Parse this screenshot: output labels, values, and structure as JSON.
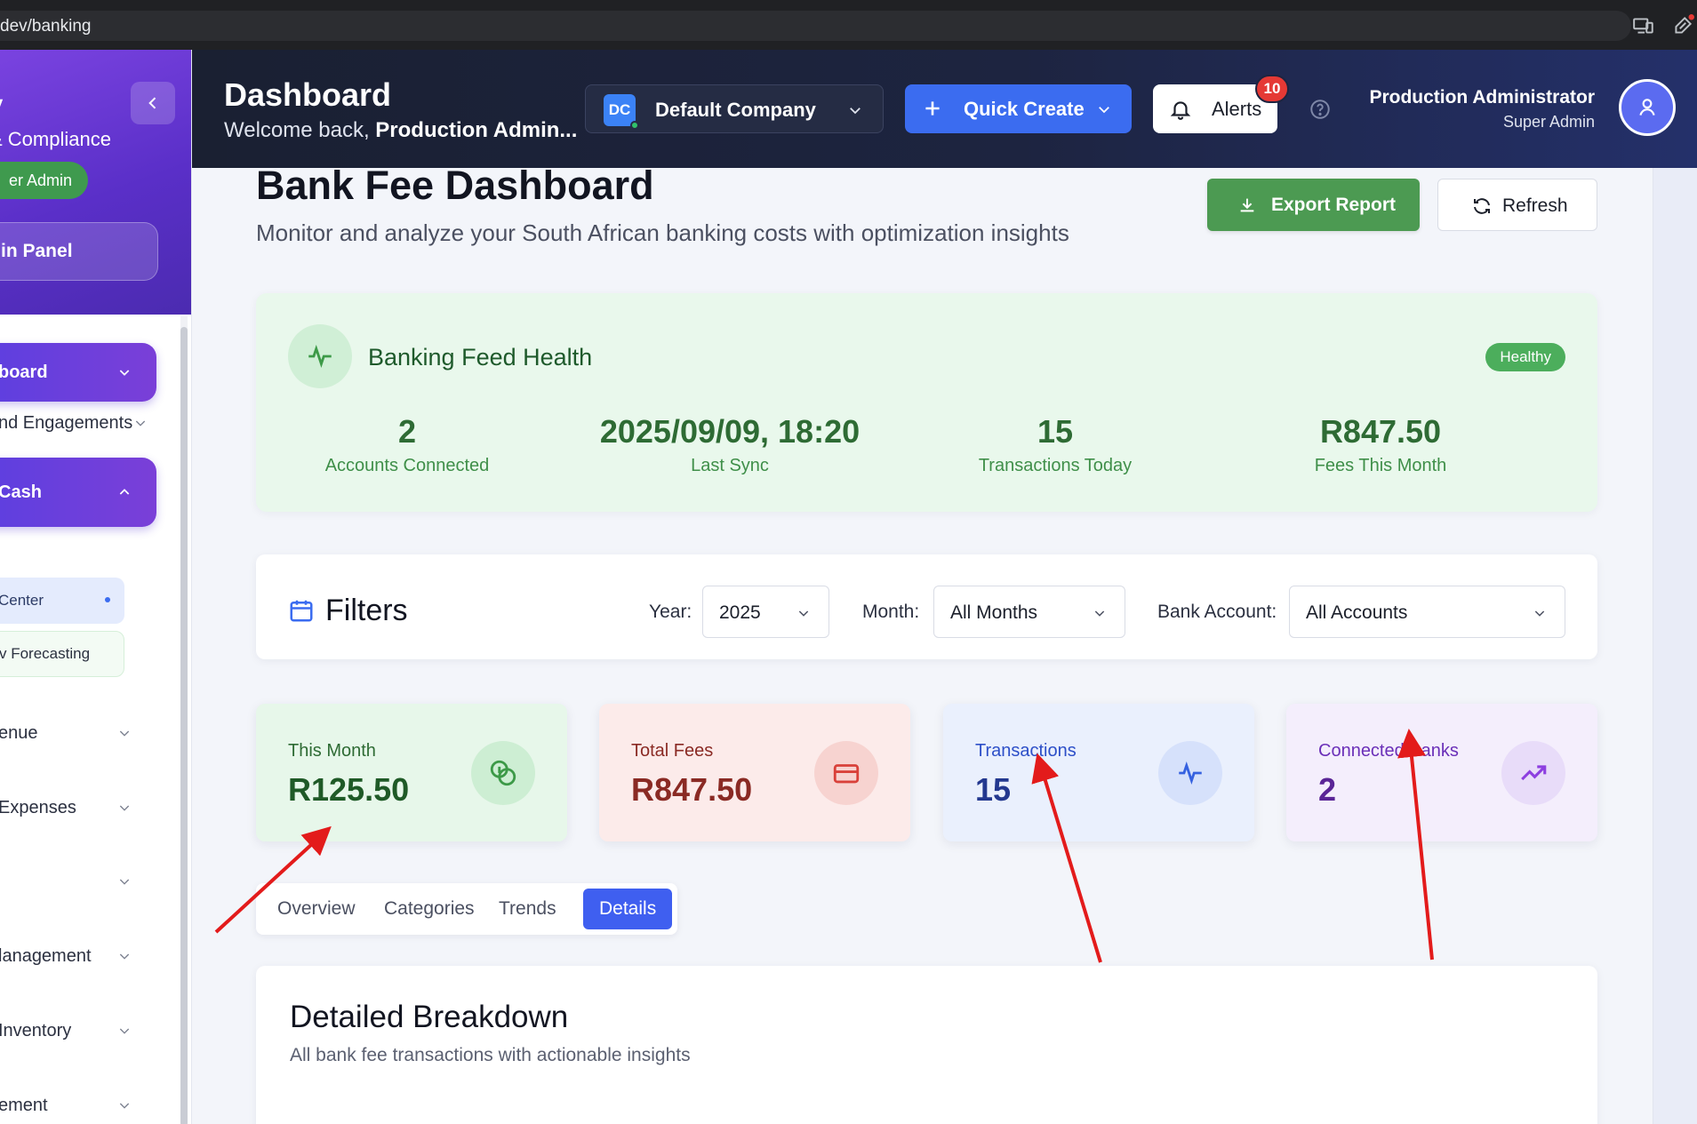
{
  "browser": {
    "url_text": "dev/banking"
  },
  "sidebar": {
    "brand_name": "fy",
    "brand_subtitle": "& Compliance",
    "role_pill": "er Admin",
    "admin_panel": "in Panel",
    "items": [
      {
        "label": "board",
        "active": true,
        "expanded": false
      },
      {
        "label": "nd Engagements",
        "active": false
      },
      {
        "label": "Cash",
        "active": true,
        "expanded": true
      },
      {
        "label": "Center",
        "sub": true,
        "selected": true
      },
      {
        "label": "v Forecasting",
        "sub": true
      },
      {
        "label": "enue",
        "active": false
      },
      {
        "label": " Expenses",
        "active": false
      },
      {
        "label": "",
        "active": false
      },
      {
        "label": "lanagement",
        "active": false
      },
      {
        "label": "Inventory",
        "active": false
      },
      {
        "label": "ement",
        "active": false
      }
    ]
  },
  "header": {
    "title": "Dashboard",
    "welcome_prefix": "Welcome back, ",
    "welcome_name": "Production Admin...",
    "company": {
      "initials": "DC",
      "name": "Default Company"
    },
    "quick_create_label": "Quick Create",
    "alerts_label": "Alerts",
    "alerts_count": "10",
    "user_name": "Production Administrator",
    "user_role": "Super Admin"
  },
  "page": {
    "title": "Bank Fee Dashboard",
    "subtitle": "Monitor and analyze your South African banking costs with optimization insights",
    "export_label": "Export Report",
    "refresh_label": "Refresh"
  },
  "feed_health": {
    "title": "Banking Feed Health",
    "status": "Healthy",
    "stats": [
      {
        "value": "2",
        "label": "Accounts Connected"
      },
      {
        "value": "2025/09/09, 18:20",
        "label": "Last Sync"
      },
      {
        "value": "15",
        "label": "Transactions Today"
      },
      {
        "value": "R847.50",
        "label": "Fees This Month"
      }
    ]
  },
  "filters": {
    "title": "Filters",
    "year_label": "Year:",
    "year_value": "2025",
    "month_label": "Month:",
    "month_value": "All Months",
    "account_label": "Bank Account:",
    "account_value": "All Accounts"
  },
  "kpis": [
    {
      "label": "This Month",
      "value": "R125.50",
      "icon": "coins-icon",
      "bg": "#e7f7ea",
      "label_color": "#2e6b34",
      "value_color": "#1f5a27",
      "icon_bg": "#cdeed3",
      "icon_color": "#3d9a48"
    },
    {
      "label": "Total Fees",
      "value": "R847.50",
      "icon": "credit-card-icon",
      "bg": "#fcebea",
      "label_color": "#8a2a24",
      "value_color": "#8a2a24",
      "icon_bg": "#f7d3d0",
      "icon_color": "#d9413a"
    },
    {
      "label": "Transactions",
      "value": "15",
      "icon": "activity-icon",
      "bg": "#eaf0fd",
      "label_color": "#2d4fc8",
      "value_color": "#23388f",
      "icon_bg": "#d6e1fb",
      "icon_color": "#3561e0"
    },
    {
      "label": "Connected Banks",
      "value": "2",
      "icon": "trending-up-icon",
      "bg": "#f4eefc",
      "label_color": "#6a2fb8",
      "value_color": "#5a2596",
      "icon_bg": "#e8dcf9",
      "icon_color": "#8d3fe0"
    }
  ],
  "tabs": [
    {
      "label": "Overview",
      "active": false
    },
    {
      "label": "Categories",
      "active": false
    },
    {
      "label": "Trends",
      "active": false
    },
    {
      "label": "Details",
      "active": true
    }
  ],
  "breakdown": {
    "title": "Detailed Breakdown",
    "subtitle": "All bank fee transactions with actionable insights"
  },
  "colors": {
    "accent": "#3b6cf0",
    "success": "#4c9a52",
    "header_bg": "#1d2440",
    "sidebar_active": "#5b3fe0",
    "annotation_arrow": "#e31b1b"
  }
}
